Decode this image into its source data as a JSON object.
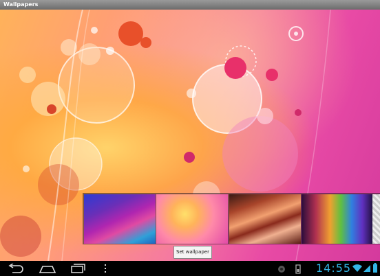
{
  "window": {
    "title": "Wallpapers"
  },
  "wallpaper_picker": {
    "thumbnails": [
      {
        "name": "blue-purple-waves"
      },
      {
        "name": "pink-bubbles-selected"
      },
      {
        "name": "red-canyon"
      },
      {
        "name": "colorful-spectrum"
      },
      {
        "name": "checker-partial"
      }
    ],
    "set_button_label": "Set wallpaper"
  },
  "status_bar": {
    "time": "14:55"
  },
  "colors": {
    "accent": "#33b5e5",
    "titlebar": "#7a7a7a"
  },
  "icons": [
    "back-icon",
    "home-icon",
    "recent-apps-icon",
    "menu-icon",
    "notification-icon",
    "sd-card-icon",
    "wifi-icon",
    "signal-icon",
    "battery-icon"
  ]
}
